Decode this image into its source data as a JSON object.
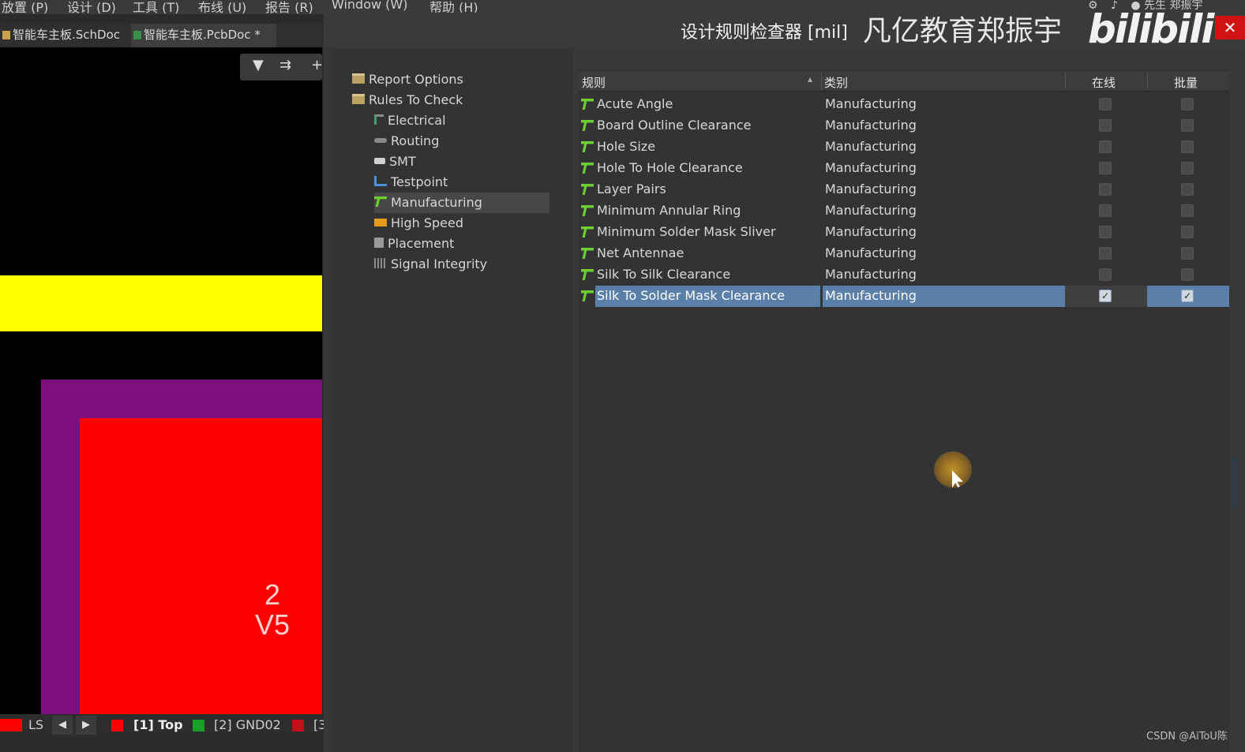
{
  "menubar": {
    "items": [
      "放置 (P)",
      "设计 (D)",
      "工具 (T)",
      "布线 (U)",
      "报告 (R)",
      "Window (W)",
      "帮助 (H)"
    ],
    "right_user": "先生 郑振宇"
  },
  "doc_tabs": [
    {
      "label": "智能车主板.SchDoc",
      "active": false
    },
    {
      "label": "智能车主板.PcbDoc *",
      "active": true
    }
  ],
  "pcb": {
    "pad_number": "2",
    "pad_net": "V5",
    "colors": {
      "trace": "#ffff00",
      "pad_outer": "#7d0f7f",
      "pad_inner": "#ff0000",
      "background": "#000000"
    }
  },
  "layer_bar": {
    "ls_label": "LS",
    "layers": [
      {
        "label": "[1] Top",
        "color": "#ff0000"
      },
      {
        "label": "[2] GND02",
        "color": "#1a9e2a"
      },
      {
        "label": "[3",
        "color": "#c0101a"
      }
    ]
  },
  "dialog": {
    "title": "设计规则检查器 [mil]",
    "overlay_text": "凡亿教育郑振宇",
    "logo_text": "bilibili",
    "close_label": "✕",
    "tree": {
      "report_options": "Report Options",
      "rules_to_check": "Rules To Check",
      "categories": [
        {
          "label": "Electrical",
          "icon": "electrical-icon"
        },
        {
          "label": "Routing",
          "icon": "routing-icon"
        },
        {
          "label": "SMT",
          "icon": "smt-icon"
        },
        {
          "label": "Testpoint",
          "icon": "testpoint-icon"
        },
        {
          "label": "Manufacturing",
          "icon": "manufacturing-icon",
          "selected": true
        },
        {
          "label": "High Speed",
          "icon": "high-speed-icon"
        },
        {
          "label": "Placement",
          "icon": "placement-icon"
        },
        {
          "label": "Signal Integrity",
          "icon": "signal-integrity-icon"
        }
      ]
    },
    "grid": {
      "columns": {
        "rule": "规则",
        "category": "类别",
        "online": "在线",
        "batch": "批量"
      },
      "rows": [
        {
          "rule": "Acute Angle",
          "category": "Manufacturing",
          "online": false,
          "batch": false
        },
        {
          "rule": "Board Outline Clearance",
          "category": "Manufacturing",
          "online": false,
          "batch": false
        },
        {
          "rule": "Hole Size",
          "category": "Manufacturing",
          "online": false,
          "batch": false
        },
        {
          "rule": "Hole To Hole Clearance",
          "category": "Manufacturing",
          "online": false,
          "batch": false
        },
        {
          "rule": "Layer Pairs",
          "category": "Manufacturing",
          "online": false,
          "batch": false
        },
        {
          "rule": "Minimum Annular Ring",
          "category": "Manufacturing",
          "online": false,
          "batch": false
        },
        {
          "rule": "Minimum Solder Mask Sliver",
          "category": "Manufacturing",
          "online": false,
          "batch": false
        },
        {
          "rule": "Net Antennae",
          "category": "Manufacturing",
          "online": false,
          "batch": false
        },
        {
          "rule": "Silk To Silk Clearance",
          "category": "Manufacturing",
          "online": false,
          "batch": false
        },
        {
          "rule": "Silk To Solder Mask Clearance",
          "category": "Manufacturing",
          "online": true,
          "batch": true,
          "selected": true
        }
      ]
    }
  },
  "watermark": "CSDN @AiToU陈",
  "accent": {
    "selection": "#5a7fa8",
    "close": "#d11212"
  }
}
